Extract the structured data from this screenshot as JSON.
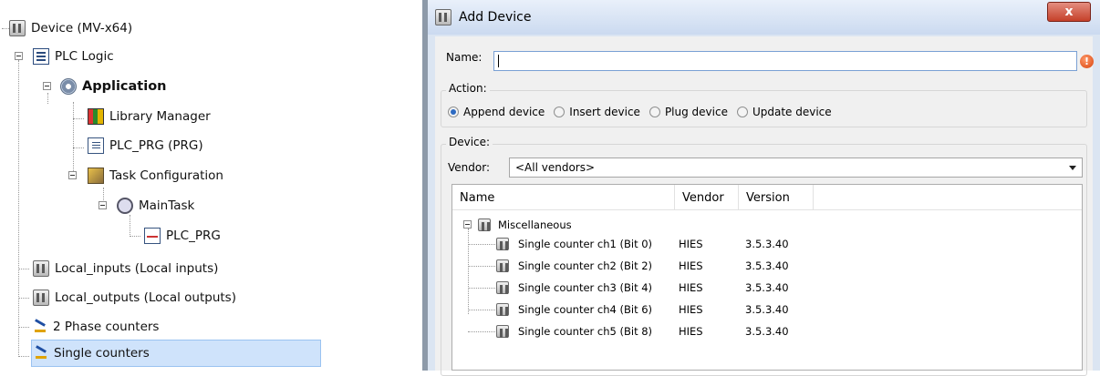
{
  "tree": {
    "items": [
      {
        "label": "Device (MV-x64)",
        "icon": "device-icon"
      },
      {
        "label": "PLC Logic",
        "icon": "plc-logic-icon"
      },
      {
        "label": "Application",
        "icon": "application-gear-icon"
      },
      {
        "label": "Library Manager",
        "icon": "library-books-icon"
      },
      {
        "label": "PLC_PRG (PRG)",
        "icon": "program-doc-icon"
      },
      {
        "label": "Task Configuration",
        "icon": "task-config-icon"
      },
      {
        "label": "MainTask",
        "icon": "maintask-icon"
      },
      {
        "label": "PLC_PRG",
        "icon": "program-call-icon"
      },
      {
        "label": "Local_inputs (Local inputs)",
        "icon": "device-icon"
      },
      {
        "label": "Local_outputs (Local outputs)",
        "icon": "device-icon"
      },
      {
        "label": "2 Phase counters",
        "icon": "counter-icon"
      },
      {
        "label": "Single counters",
        "icon": "counter-icon"
      }
    ]
  },
  "dialog": {
    "title": "Add Device",
    "close_label": "x",
    "name_label": "Name:",
    "name_value": "",
    "error_mark": "!",
    "action_label": "Action:",
    "actions": [
      {
        "label": "Append device",
        "selected": true
      },
      {
        "label": "Insert device",
        "selected": false
      },
      {
        "label": "Plug device",
        "selected": false
      },
      {
        "label": "Update device",
        "selected": false
      }
    ],
    "device_label": "Device:",
    "vendor_label": "Vendor:",
    "vendor_value": "<All vendors>",
    "columns": [
      "Name",
      "Vendor",
      "Version"
    ],
    "category": "Miscellaneous",
    "rows": [
      {
        "name": "Single counter ch1 (Bit 0)",
        "vendor": "HIES",
        "version": "3.5.3.40"
      },
      {
        "name": "Single counter ch2 (Bit 2)",
        "vendor": "HIES",
        "version": "3.5.3.40"
      },
      {
        "name": "Single counter ch3 (Bit 4)",
        "vendor": "HIES",
        "version": "3.5.3.40"
      },
      {
        "name": "Single counter ch4 (Bit 6)",
        "vendor": "HIES",
        "version": "3.5.3.40"
      },
      {
        "name": "Single counter ch5 (Bit 8)",
        "vendor": "HIES",
        "version": "3.5.3.40"
      }
    ]
  },
  "colors": {
    "selection": "#cfe3fb",
    "title_bar": "#cbdaf0",
    "close_button": "#c5402a",
    "error": "#d8420c"
  }
}
